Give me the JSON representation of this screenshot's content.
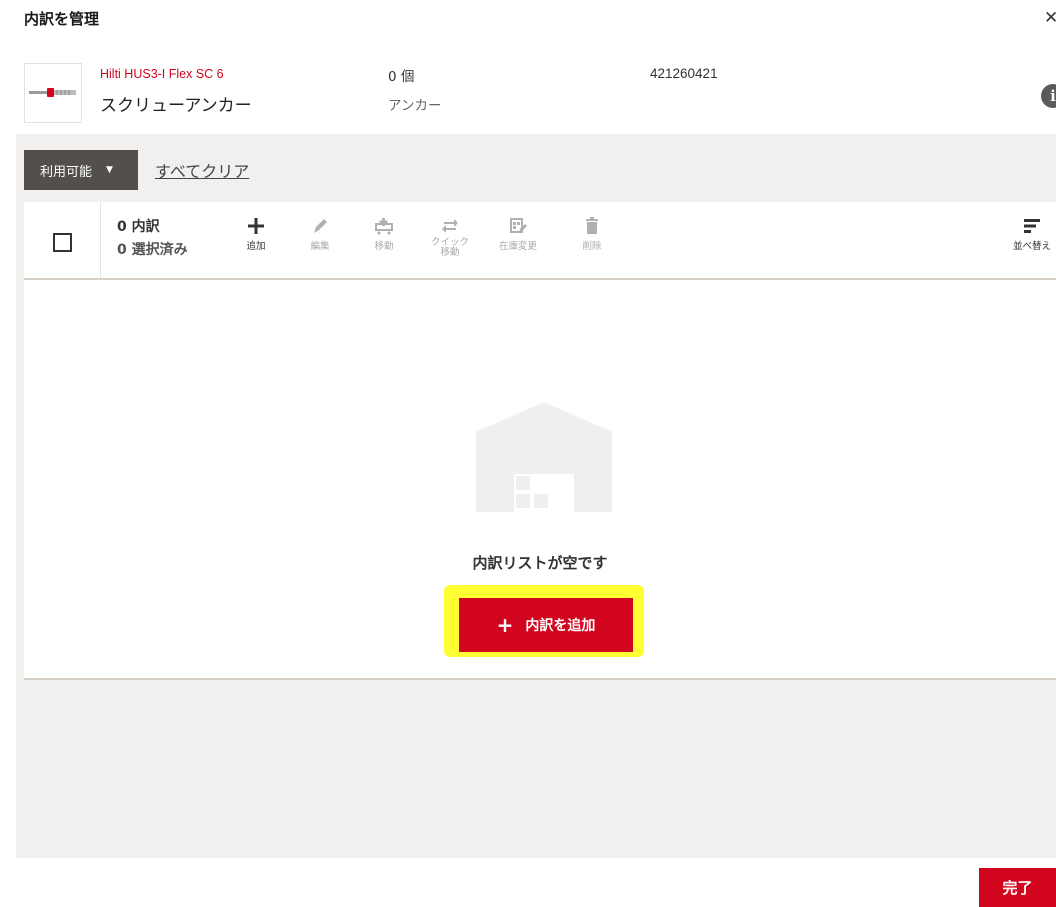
{
  "dialog": {
    "title": "内訳を管理",
    "close_label": "✕"
  },
  "product": {
    "name": "Hilti HUS3-I Flex SC 6",
    "type": "スクリューアンカー",
    "quantity": "0 個",
    "category": "アンカー",
    "article_number": "421260421",
    "info_label": "i"
  },
  "filter": {
    "dropdown_label": "利用可能",
    "caret": "▼",
    "clear_all": "すべてクリア"
  },
  "toolbar": {
    "count_main": "0 内訳",
    "count_selected": "0 選択済み",
    "tools": [
      {
        "label": "追加",
        "icon": "plus-icon",
        "enabled": true
      },
      {
        "label": "編集",
        "icon": "pencil-icon",
        "enabled": false
      },
      {
        "label": "移動",
        "icon": "move-icon",
        "enabled": false
      },
      {
        "label": "クイック\n移動",
        "icon": "swap-arrows-icon",
        "enabled": false
      },
      {
        "label": "在庫変更",
        "icon": "inventory-edit-icon",
        "enabled": false
      },
      {
        "label": "削除",
        "icon": "trash-icon",
        "enabled": false
      }
    ],
    "sort_label": "並べ替え"
  },
  "empty_state": {
    "message": "内訳リストが空です",
    "add_button_label": "内訳を追加",
    "add_button_icon": "+"
  },
  "footer": {
    "done_label": "完了"
  },
  "colors": {
    "brand_red": "#d2051e",
    "panel_gray": "#f2f0ee",
    "highlight": "#ffff33",
    "dark_button": "#524f4d"
  }
}
